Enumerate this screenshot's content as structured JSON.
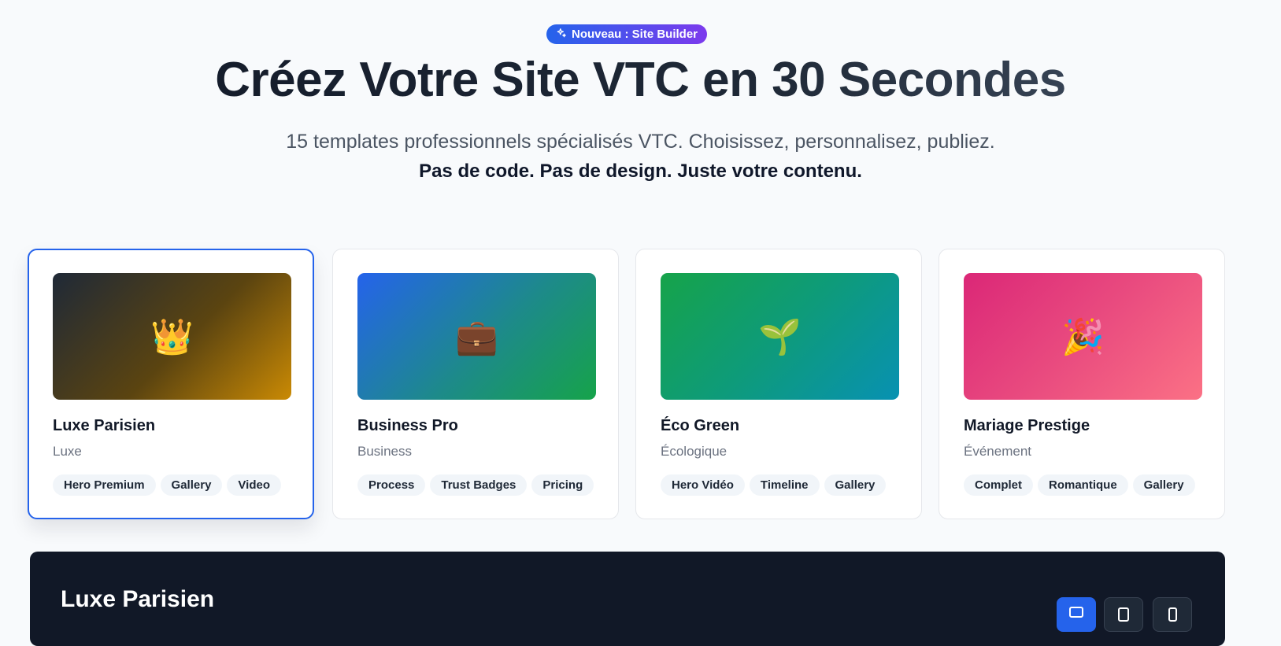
{
  "header": {
    "badge_icon": "sparkles-icon",
    "badge_label": "Nouveau : Site Builder",
    "title": "Créez Votre Site VTC en 30 Secondes",
    "subtitle": "15 templates professionnels spécialisés VTC. Choisissez, personnalisez, publiez.",
    "tagline": "Pas de code. Pas de design. Juste votre contenu."
  },
  "templates": [
    {
      "name": "Luxe Parisien",
      "category": "Luxe",
      "emoji": "👑",
      "icon": "crown-icon",
      "gradient": [
        "#1f2937",
        "#ca8a04"
      ],
      "selected": true,
      "tags": [
        "Hero Premium",
        "Gallery",
        "Video"
      ]
    },
    {
      "name": "Business Pro",
      "category": "Business",
      "emoji": "💼",
      "icon": "briefcase-icon",
      "gradient": [
        "#2563eb",
        "#16a34a"
      ],
      "selected": false,
      "tags": [
        "Process",
        "Trust Badges",
        "Pricing"
      ]
    },
    {
      "name": "Éco Green",
      "category": "Écologique",
      "emoji": "🌱",
      "icon": "seedling-icon",
      "gradient": [
        "#16a34a",
        "#0891b2"
      ],
      "selected": false,
      "tags": [
        "Hero Vidéo",
        "Timeline",
        "Gallery"
      ]
    },
    {
      "name": "Mariage Prestige",
      "category": "Événement",
      "emoji": "🎉",
      "icon": "party-popper-icon",
      "gradient": [
        "#db2777",
        "#fb7185"
      ],
      "selected": false,
      "tags": [
        "Complet",
        "Romantique",
        "Gallery"
      ]
    }
  ],
  "preview": {
    "title": "Luxe Parisien",
    "devices": [
      "desktop-icon",
      "tablet-icon",
      "mobile-icon"
    ],
    "active_device": "desktop-icon"
  },
  "colors": {
    "accent": "#2563eb",
    "badge_gradient": [
      "#2563eb",
      "#7c3aed"
    ],
    "preview_bg": "#111827"
  }
}
